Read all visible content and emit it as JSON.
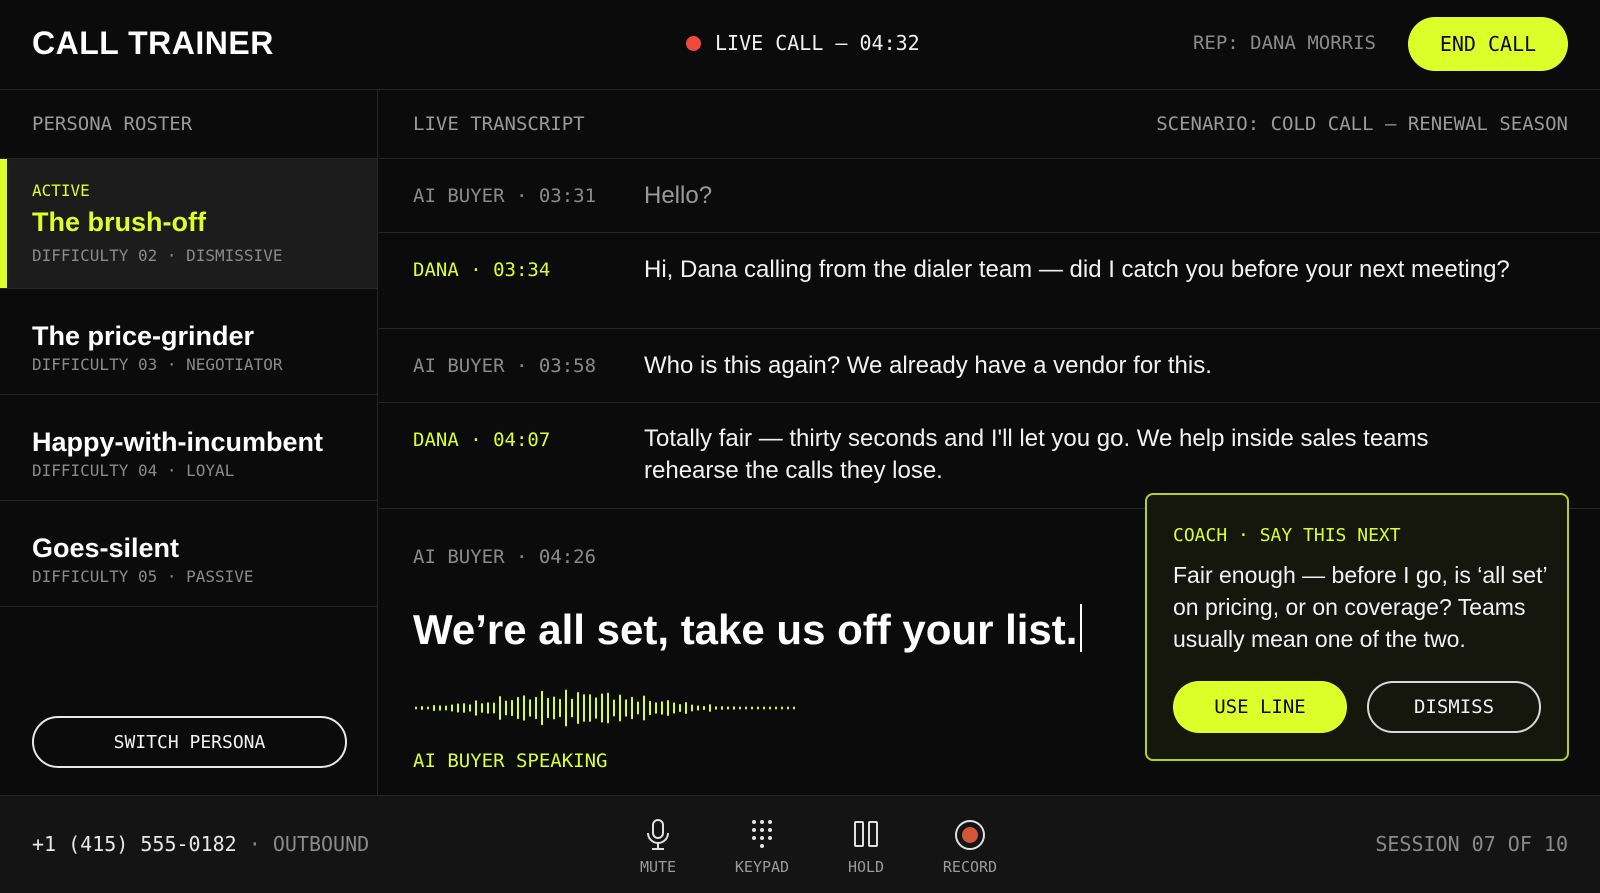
{
  "app": {
    "title": "CALL TRAINER"
  },
  "header": {
    "live_status": "LIVE CALL — 04:32",
    "rep": "REP: DANA MORRIS",
    "end_call": "END CALL"
  },
  "sidebar": {
    "title": "PERSONA ROSTER",
    "active_label": "ACTIVE",
    "personas": [
      {
        "name": "The brush-off",
        "meta": "DIFFICULTY 02 · DISMISSIVE",
        "active": true
      },
      {
        "name": "The price-grinder",
        "meta": "DIFFICULTY 03 · NEGOTIATOR",
        "active": false
      },
      {
        "name": "Happy-with-incumbent",
        "meta": "DIFFICULTY 04 · LOYAL",
        "active": false
      },
      {
        "name": "Goes-silent",
        "meta": "DIFFICULTY 05 · PASSIVE",
        "active": false
      }
    ],
    "switch_button": "SWITCH PERSONA"
  },
  "transcript": {
    "title": "LIVE TRANSCRIPT",
    "scenario": "SCENARIO: COLD CALL — RENEWAL SEASON",
    "lines": [
      {
        "speaker": "AI BUYER · 03:31",
        "text": "Hello?"
      },
      {
        "speaker": "DANA · 03:34",
        "text": "Hi, Dana calling from the dialer team — did I catch you before your next meeting?"
      },
      {
        "speaker": "AI BUYER · 03:58",
        "text": "Who is this again? We already have a vendor for this."
      },
      {
        "speaker": "DANA · 04:07",
        "text": "Totally fair — thirty seconds and I'll let you go. We help inside sales teams rehearse the calls they lose."
      }
    ],
    "current": {
      "speaker": "AI BUYER · 04:26",
      "text": "We’re all set, take us off your list.",
      "status": "AI BUYER SPEAKING"
    }
  },
  "coach": {
    "label": "COACH · SAY THIS NEXT",
    "text": "Fair enough — before I go, is ‘all set’ on pricing, or on coverage? Teams usually mean one of the two.",
    "use_line": "USE LINE",
    "dismiss": "DISMISS"
  },
  "footer": {
    "phone": "+1 (415) 555-0182",
    "separator": "·",
    "direction": "OUTBOUND",
    "controls": [
      {
        "label": "MUTE",
        "icon": "microphone-icon"
      },
      {
        "label": "KEYPAD",
        "icon": "keypad-icon"
      },
      {
        "label": "HOLD",
        "icon": "pause-icon"
      },
      {
        "label": "RECORD",
        "icon": "record-icon"
      }
    ],
    "session": "SESSION 07 OF 10"
  },
  "colors": {
    "accent": "#dcff2a",
    "live_dot": "#ef4b3a",
    "background": "#0b0b0b",
    "active_row": "#1c1c1c"
  }
}
